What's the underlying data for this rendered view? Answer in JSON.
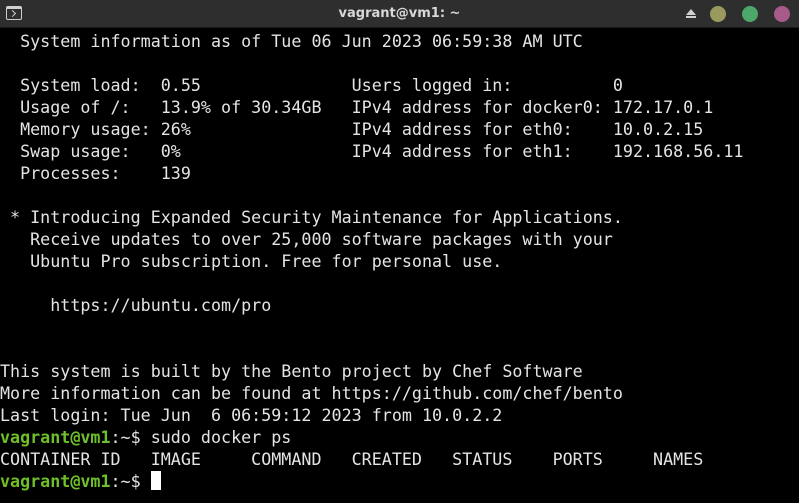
{
  "window": {
    "title": "vagrant@vm1: ~",
    "colors": {
      "titlebar": "#2e2e2e",
      "minimize": "#9a9a5e",
      "maximize": "#4da66a",
      "close": "#a85a8a"
    }
  },
  "terminal": {
    "colors": {
      "background": "#000000",
      "text": "#e4e4e4",
      "prompt": "#6fbf2a"
    },
    "lines": [
      "  System information as of Tue 06 Jun 2023 06:59:38 AM UTC",
      "",
      "  System load:  0.55               Users logged in:          0",
      "  Usage of /:   13.9% of 30.34GB   IPv4 address for docker0: 172.17.0.1",
      "  Memory usage: 26%                IPv4 address for eth0:    10.0.2.15",
      "  Swap usage:   0%                 IPv4 address for eth1:    192.168.56.11",
      "  Processes:    139",
      "",
      " * Introducing Expanded Security Maintenance for Applications.",
      "   Receive updates to over 25,000 software packages with your",
      "   Ubuntu Pro subscription. Free for personal use.",
      "",
      "     https://ubuntu.com/pro",
      "",
      "",
      "This system is built by the Bento project by Chef Software",
      "More information can be found at https://github.com/chef/bento",
      "Last login: Tue Jun  6 06:59:12 2023 from 10.0.2.2"
    ],
    "command_line": {
      "prompt": "vagrant@vm1",
      "suffix": ":~$ ",
      "command": "sudo docker ps"
    },
    "output_header": "CONTAINER ID   IMAGE     COMMAND   CREATED   STATUS    PORTS     NAMES",
    "active_prompt": {
      "prompt": "vagrant@vm1",
      "suffix": ":~$ "
    }
  }
}
